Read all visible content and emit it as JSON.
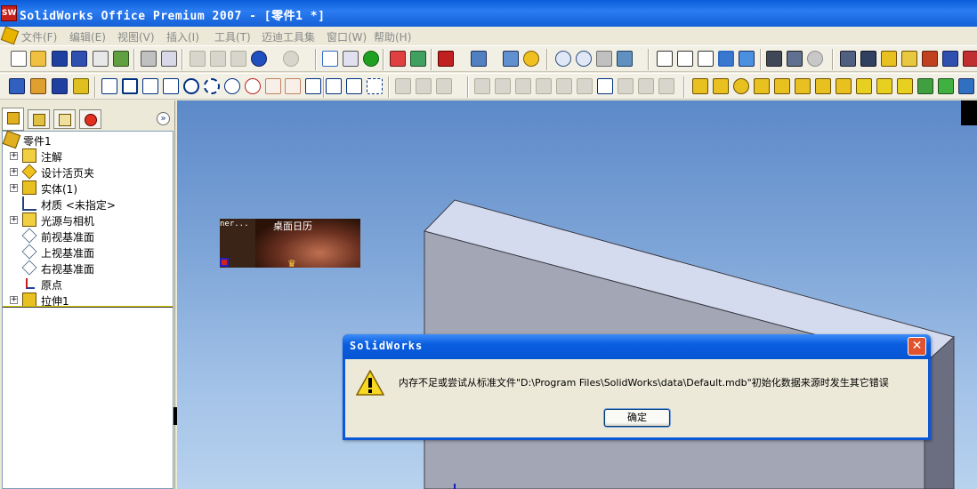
{
  "window": {
    "title": "SolidWorks Office Premium 2007 - [零件1 *]",
    "app_icon_text": "SW"
  },
  "menu": [
    {
      "label": "文件(F)"
    },
    {
      "label": "编辑(E)"
    },
    {
      "label": "视图(V)"
    },
    {
      "label": "插入(I)"
    },
    {
      "label": "工具(T)"
    },
    {
      "label": "迈迪工具集"
    },
    {
      "label": "窗口(W)"
    },
    {
      "label": "帮助(H)"
    }
  ],
  "feature_tree": {
    "root": "零件1",
    "items": [
      {
        "label": "注解",
        "icon": "annotation-icon",
        "expandable": true
      },
      {
        "label": "设计活页夹",
        "icon": "design-binder-icon",
        "expandable": true
      },
      {
        "label": "实体(1)",
        "icon": "solid-bodies-icon",
        "expandable": true
      },
      {
        "label": "材质 <未指定>",
        "icon": "material-icon",
        "expandable": false
      },
      {
        "label": "光源与相机",
        "icon": "lights-camera-icon",
        "expandable": true
      },
      {
        "label": "前视基准面",
        "icon": "plane-icon",
        "expandable": false
      },
      {
        "label": "上视基准面",
        "icon": "plane-icon",
        "expandable": false
      },
      {
        "label": "右视基准面",
        "icon": "plane-icon",
        "expandable": false
      },
      {
        "label": "原点",
        "icon": "origin-icon",
        "expandable": false
      },
      {
        "label": "拉伸1",
        "icon": "extrude-icon",
        "expandable": true
      }
    ],
    "expand_glyph": "»"
  },
  "overlay_thumbnail": {
    "left_text": "ner...",
    "title": "桌面日历"
  },
  "dialog": {
    "title": "SolidWorks",
    "message": "内存不足或尝试从标准文件\"D:\\Program Files\\SolidWorks\\data\\Default.mdb\"初始化数据来源时发生其它错误",
    "ok_label": "确定",
    "close_glyph": "✕"
  },
  "colors": {
    "title_bar": "#1560d6",
    "viewport_top": "#5c89c8",
    "viewport_bottom": "#b8d2ee",
    "part_face_front": "#a3a7b5",
    "part_face_top": "#d4dbee"
  }
}
